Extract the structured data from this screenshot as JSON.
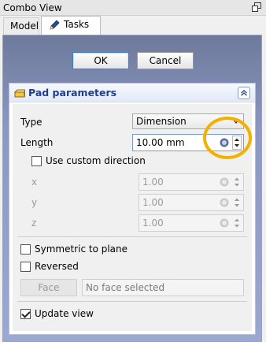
{
  "window": {
    "title": "Combo View"
  },
  "tabs": {
    "model": "Model",
    "tasks": "Tasks"
  },
  "dialog": {
    "ok_label": "OK",
    "cancel_label": "Cancel"
  },
  "pad": {
    "title": "Pad parameters",
    "type_label": "Type",
    "type_value": "Dimension",
    "length_label": "Length",
    "length_value": "10.00 mm",
    "custom_direction_label": "Use custom direction",
    "x_label": "x",
    "x_value": "1.00",
    "y_label": "y",
    "y_value": "1.00",
    "z_label": "z",
    "z_value": "1.00",
    "symmetric_label": "Symmetric to plane",
    "reversed_label": "Reversed",
    "face_button": "Face",
    "face_field": "No face selected",
    "update_view_label": "Update view",
    "update_view_checked": true,
    "custom_direction_checked": false,
    "symmetric_checked": false,
    "reversed_checked": false
  },
  "icons": {
    "float": "float-window-icon",
    "pencil": "pencil-icon",
    "pad": "pad-feature-icon",
    "collapse": "collapse-chevron-icon",
    "units": "units-expression-icon"
  },
  "colors": {
    "highlight": "#f2b000",
    "header_text": "#1e3f8a"
  }
}
